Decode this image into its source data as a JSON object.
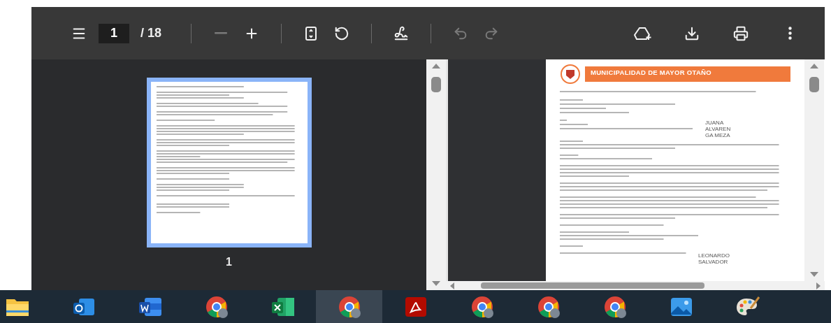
{
  "toolbar": {
    "menu": {
      "kind": "menu",
      "disabled": false
    },
    "page_number": "1",
    "page_total": "/ 18",
    "groups": [
      [
        {
          "kind": "zoom_out",
          "disabled": true
        },
        {
          "kind": "zoom_in",
          "disabled": false
        }
      ],
      [
        {
          "kind": "fit",
          "disabled": false
        },
        {
          "kind": "rotate",
          "disabled": false
        }
      ],
      [
        {
          "kind": "draw",
          "disabled": false
        }
      ],
      [
        {
          "kind": "undo",
          "disabled": true
        },
        {
          "kind": "redo",
          "disabled": true
        }
      ]
    ],
    "right": [
      {
        "kind": "add_drive",
        "disabled": false
      },
      {
        "kind": "download",
        "disabled": false
      },
      {
        "kind": "print",
        "disabled": false
      },
      {
        "kind": "more",
        "disabled": false
      }
    ]
  },
  "thumbnails": [
    {
      "label": "1",
      "selected": true
    }
  ],
  "document": {
    "header_title": "MUNICIPALIDAD DE MAYOR OTAÑO",
    "signature_top": [
      "JUANA",
      "ALVAREN",
      "GA MEZA"
    ],
    "signature_bottom": [
      "LEONARDO",
      "SALVADOR"
    ]
  },
  "taskbar": [
    {
      "kind": "folder",
      "selected": false
    },
    {
      "kind": "mail",
      "selected": false
    },
    {
      "kind": "word",
      "selected": false
    },
    {
      "kind": "browser",
      "selected": false
    },
    {
      "kind": "sheet",
      "selected": false
    },
    {
      "kind": "browser",
      "selected": true
    },
    {
      "kind": "pdf",
      "selected": false
    },
    {
      "kind": "browser",
      "selected": false
    },
    {
      "kind": "browser",
      "selected": false
    },
    {
      "kind": "browser",
      "selected": false
    },
    {
      "kind": "photos",
      "selected": false
    },
    {
      "kind": "paint",
      "selected": false
    }
  ]
}
